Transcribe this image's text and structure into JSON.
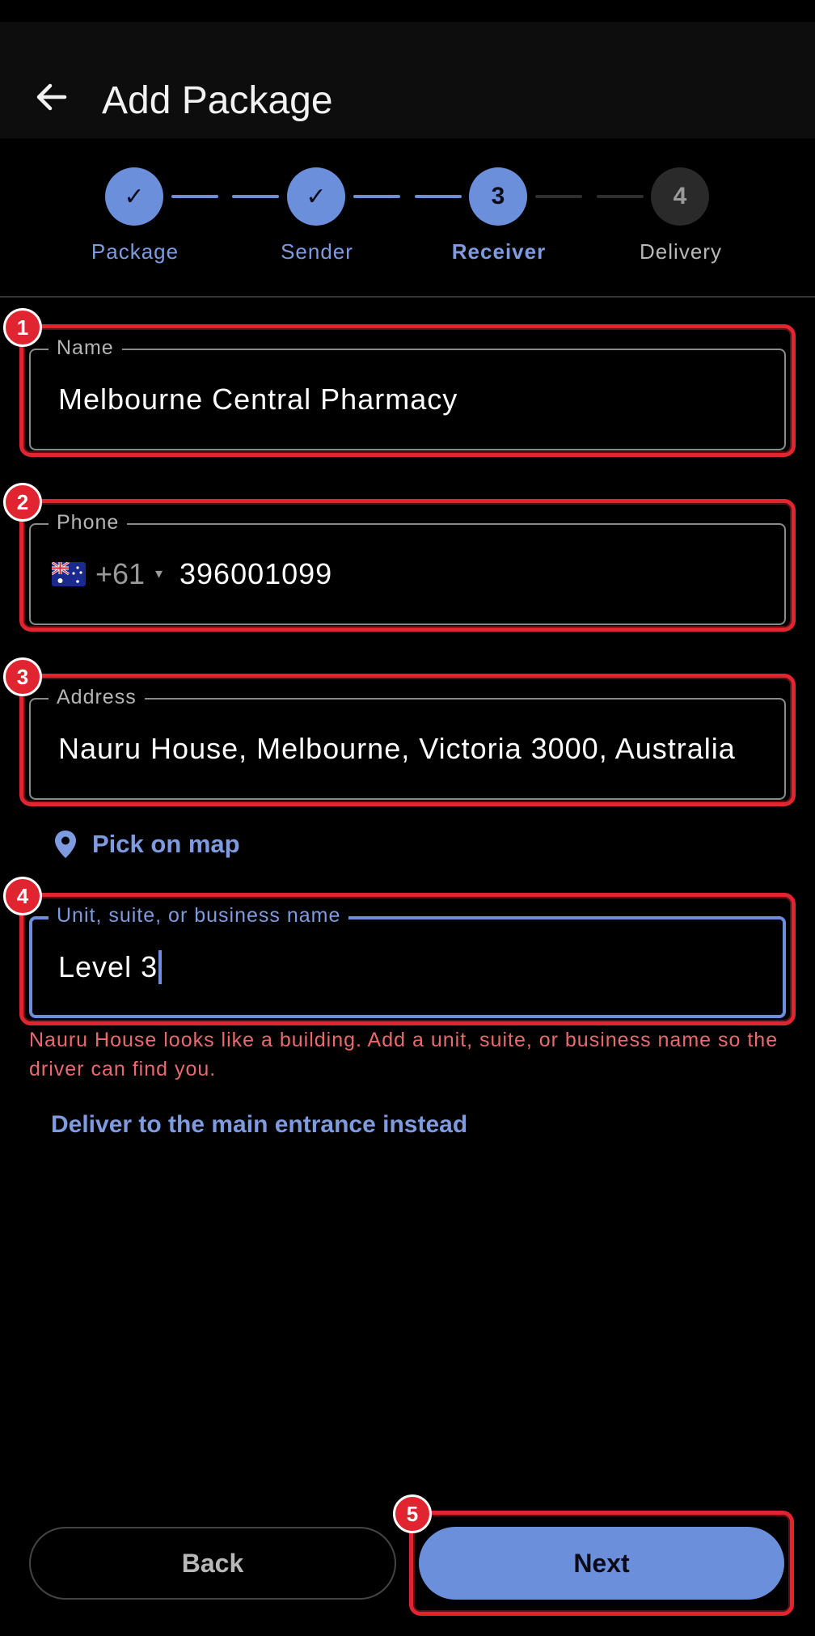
{
  "appbar": {
    "title": "Add Package",
    "back_icon": "arrow-left-icon"
  },
  "stepper": {
    "steps": [
      {
        "label": "Package",
        "marker": "✓",
        "state": "done"
      },
      {
        "label": "Sender",
        "marker": "✓",
        "state": "done"
      },
      {
        "label": "Receiver",
        "marker": "3",
        "state": "active"
      },
      {
        "label": "Delivery",
        "marker": "4",
        "state": "todo"
      }
    ]
  },
  "form": {
    "name": {
      "label": "Name",
      "value": "Melbourne Central Pharmacy"
    },
    "phone": {
      "label": "Phone",
      "flag_icon": "australia-flag-icon",
      "dial_code": "+61",
      "dial_caret": "▾",
      "value": "396001099"
    },
    "address": {
      "label": "Address",
      "value": "Nauru House, Melbourne, Victoria 3000, Australia"
    },
    "pick_on_map": {
      "label": "Pick on map",
      "icon": "map-pin-icon"
    },
    "unit": {
      "label": "Unit, suite, or business name",
      "value": "Level 3"
    },
    "error": "Nauru House looks like a building. Add a unit, suite, or business name so the driver can find you.",
    "entrance_link": "Deliver to the main entrance instead"
  },
  "buttons": {
    "back": "Back",
    "next": "Next"
  },
  "annotations": [
    "1",
    "2",
    "3",
    "4",
    "5"
  ],
  "colors": {
    "accent": "#6b8fdb",
    "annotation": "#e02430",
    "error": "#e86a70",
    "background": "#000000"
  }
}
